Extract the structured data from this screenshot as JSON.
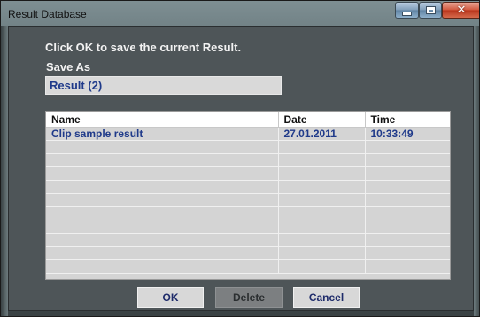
{
  "window": {
    "title": "Result Database"
  },
  "dialog": {
    "prompt": "Click OK to save the current Result.",
    "save_as_label": "Save As",
    "save_as_value": "Result (2)"
  },
  "table": {
    "columns": [
      "Name",
      "Date",
      "Time"
    ],
    "rows": [
      [
        "Clip sample result",
        "27.01.2011",
        "10:33:49"
      ]
    ]
  },
  "buttons": {
    "ok": "OK",
    "delete": "Delete",
    "cancel": "Cancel"
  },
  "colors": {
    "dialog_bg": "#4e5558",
    "grid_bg": "#d4d4d4",
    "cell_text": "#1f3a8a",
    "close_button": "#d1553a"
  }
}
